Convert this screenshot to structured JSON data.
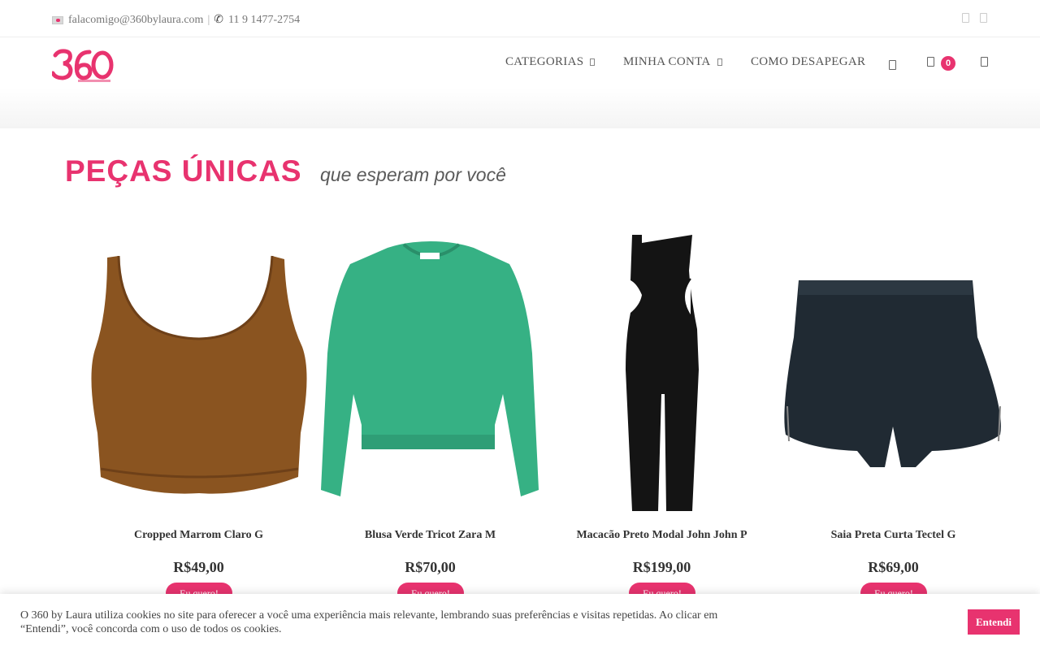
{
  "topbar": {
    "email": "falacomigo@360bylaura.com",
    "separator": "|",
    "phone": "11 9 1477-2754",
    "social_icons": [
      "social-icon-1",
      "social-icon-2"
    ]
  },
  "logo": {
    "brand": "360",
    "tagline": "by laura"
  },
  "nav": {
    "items": [
      {
        "label": "CATEGORIAS",
        "has_dropdown": true
      },
      {
        "label": "MINHA CONTA",
        "has_dropdown": true
      },
      {
        "label": "COMO DESAPEGAR",
        "has_dropdown": false
      }
    ],
    "cart_count": "0"
  },
  "section": {
    "title": "PEÇAS ÚNICAS",
    "subtitle": "que esperam por você"
  },
  "products": [
    {
      "name": "Cropped Marrom Claro G",
      "price": "R$49,00",
      "button": "Eu quero!"
    },
    {
      "name": "Blusa Verde Tricot Zara M",
      "price": "R$70,00",
      "button": "Eu quero!"
    },
    {
      "name": "Macacão Preto Modal John John P",
      "price": "R$199,00",
      "button": "Eu quero!"
    },
    {
      "name": "Saia Preta Curta Tectel G",
      "price": "R$69,00",
      "button": "Eu quero!"
    }
  ],
  "cookie": {
    "text": "O 360 by Laura utiliza cookies no site para oferecer a você uma experiência mais relevante, lembrando suas preferências e visitas repetidas. Ao clicar em “Entendi”, você concorda com o uso de todos os cookies.",
    "button": "Entendi"
  },
  "colors": {
    "accent": "#e8336f",
    "text": "#333333"
  }
}
